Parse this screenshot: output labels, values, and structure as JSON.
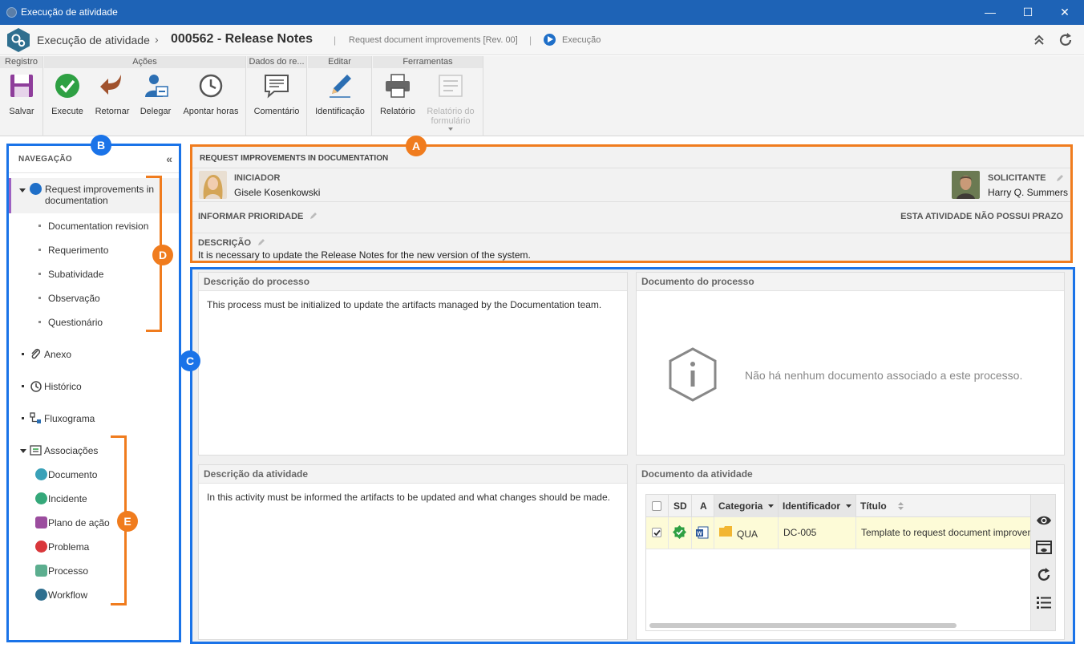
{
  "window": {
    "title": "Execução de atividade",
    "minimize": "—",
    "maximize": "☐",
    "close": "✕"
  },
  "header": {
    "crumb_app": "Execução de atividade",
    "crumb_sep": "›",
    "activity": "000562 - Release Notes",
    "pipe": "|",
    "process": "Request document improvements [Rev. 00]",
    "status": "Execução"
  },
  "ribbon": {
    "groups": {
      "registro": "Registro",
      "acoes": "Ações",
      "dados": "Dados do re...",
      "editar": "Editar",
      "ferramentas": "Ferramentas"
    },
    "buttons": {
      "salvar": "Salvar",
      "execute": "Execute",
      "retornar": "Retornar",
      "delegar": "Delegar",
      "apontar": "Apontar horas",
      "comentario": "Comentário",
      "identificacao": "Identificação",
      "relatorio": "Relatório",
      "relatorio_form": "Relatório do formulário"
    }
  },
  "nav": {
    "title": "NAVEGAÇÃO",
    "collapse": "«",
    "activity_line1": "Request improvements in",
    "activity_line2": "documentation",
    "sub_items": [
      "Documentation revision",
      "Requerimento",
      "Subatividade",
      "Observação",
      "Questionário"
    ],
    "anexo": "Anexo",
    "historico": "Histórico",
    "fluxograma": "Fluxograma",
    "associacoes": "Associações",
    "assoc_items": [
      "Documento",
      "Incidente",
      "Plano de ação",
      "Problema",
      "Processo",
      "Workflow"
    ]
  },
  "activity_info": {
    "title": "REQUEST IMPROVEMENTS IN DOCUMENTATION",
    "initiator_label": "INICIADOR",
    "initiator_name": "Gisele Kosenkowski",
    "requester_label": "SOLICITANTE",
    "requester_name": "Harry Q. Summers",
    "priority_label": "INFORMAR PRIORIDADE",
    "deadline_text": "ESTA ATIVIDADE NÃO POSSUI PRAZO",
    "description_label": "DESCRIÇÃO",
    "description": "It is necessary to update the Release Notes for the new version of the system."
  },
  "panels": {
    "process_desc_title": "Descrição do processo",
    "process_desc": "This process must be initialized to update the artifacts managed by the Documentation team.",
    "process_doc_title": "Documento do processo",
    "no_doc_msg": "Não há nenhum documento associado a este processo.",
    "activity_desc_title": "Descrição da atividade",
    "activity_desc": "In this activity must be informed the artifacts to be updated and what changes should be made.",
    "activity_doc_title": "Documento da atividade"
  },
  "doc_grid": {
    "columns": {
      "sd": "SD",
      "a": "A",
      "categoria": "Categoria",
      "identificador": "Identificador",
      "titulo": "Título"
    },
    "rows": [
      {
        "categoria": "QUA",
        "identificador": "DC-005",
        "titulo": "Template to request document improvements",
        "checked": true
      }
    ]
  },
  "callouts": {
    "a": "A",
    "b": "B",
    "c": "C",
    "d": "D",
    "e": "E"
  },
  "colors": {
    "titlebar": "#1e63b6",
    "callout_orange": "#f07c1e",
    "callout_blue": "#1a73e8",
    "selected_row": "#fdfbd7"
  }
}
